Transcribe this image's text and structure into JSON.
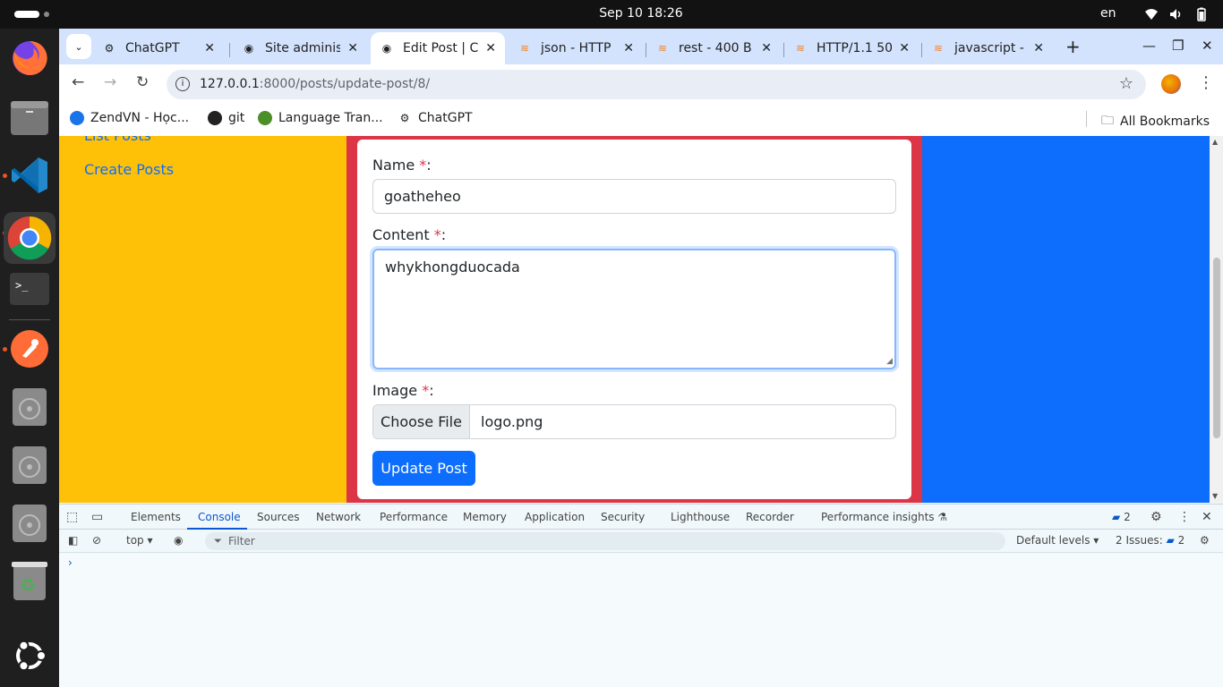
{
  "system": {
    "clock": "Sep 10  18:26",
    "language": "en"
  },
  "dock": {
    "apps": [
      "firefox-icon",
      "files-icon",
      "vscode-icon",
      "chrome-icon",
      "terminal-icon",
      "postman-icon",
      "disc-icon",
      "disc-icon",
      "disc-icon",
      "trash-icon",
      "ubuntu-apps-icon"
    ]
  },
  "browser": {
    "tabs": [
      {
        "title": "ChatGPT",
        "active": false
      },
      {
        "title": "Site adminis",
        "active": false
      },
      {
        "title": "Edit Post | C",
        "active": true
      },
      {
        "title": "json - HTTP",
        "active": false
      },
      {
        "title": "rest - 400 B",
        "active": false
      },
      {
        "title": "HTTP/1.1 50",
        "active": false
      },
      {
        "title": "javascript - H",
        "active": false
      }
    ],
    "url_host": "127.0.0.1",
    "url_path": ":8000/posts/update-post/8/",
    "bookmarks": [
      "ZendVN - Học...",
      "git",
      "Language Tran...",
      "ChatGPT"
    ],
    "all_bookmarks": "All Bookmarks"
  },
  "page": {
    "sidebar": {
      "list_posts": "List Posts",
      "create_posts": "Create Posts"
    },
    "form": {
      "name_label": "Name ",
      "name_required": "*",
      "name_suffix": ":",
      "name_value": "goatheheo",
      "content_label": "Content ",
      "content_required": "*",
      "content_suffix": ":",
      "content_value": "whykhongduocada",
      "image_label": "Image ",
      "image_required": "*",
      "image_suffix": ":",
      "choose_file": "Choose File",
      "file_name": "logo.png",
      "submit": "Update Post"
    },
    "colors": {
      "left": "#ffc107",
      "middle": "#dc3545",
      "right": "#0d6efd"
    }
  },
  "devtools": {
    "tabs": [
      "Elements",
      "Console",
      "Sources",
      "Network",
      "Performance",
      "Memory",
      "Application",
      "Security",
      "Lighthouse",
      "Recorder",
      "Performance insights"
    ],
    "active_tab": "Console",
    "issues_badge": "2",
    "context": "top",
    "filter_placeholder": "Filter",
    "levels": "Default levels",
    "issues_label": "2 Issues:",
    "issues_count": "2",
    "prompt": "›"
  }
}
